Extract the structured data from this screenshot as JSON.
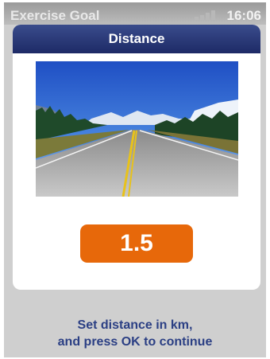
{
  "status_bar": {
    "title": "Exercise Goal",
    "time": "16:06",
    "signal_icon": "signal-strength-icon"
  },
  "dialog": {
    "title": "Distance",
    "image_icon": "road-landscape-photo",
    "value": "1.5"
  },
  "instructions": {
    "line1": "Set distance in km,",
    "line2": "and press OK to continue"
  },
  "colors": {
    "header": "#1d2a66",
    "value_box": "#e7680a",
    "hint_text": "#2b3f84"
  }
}
